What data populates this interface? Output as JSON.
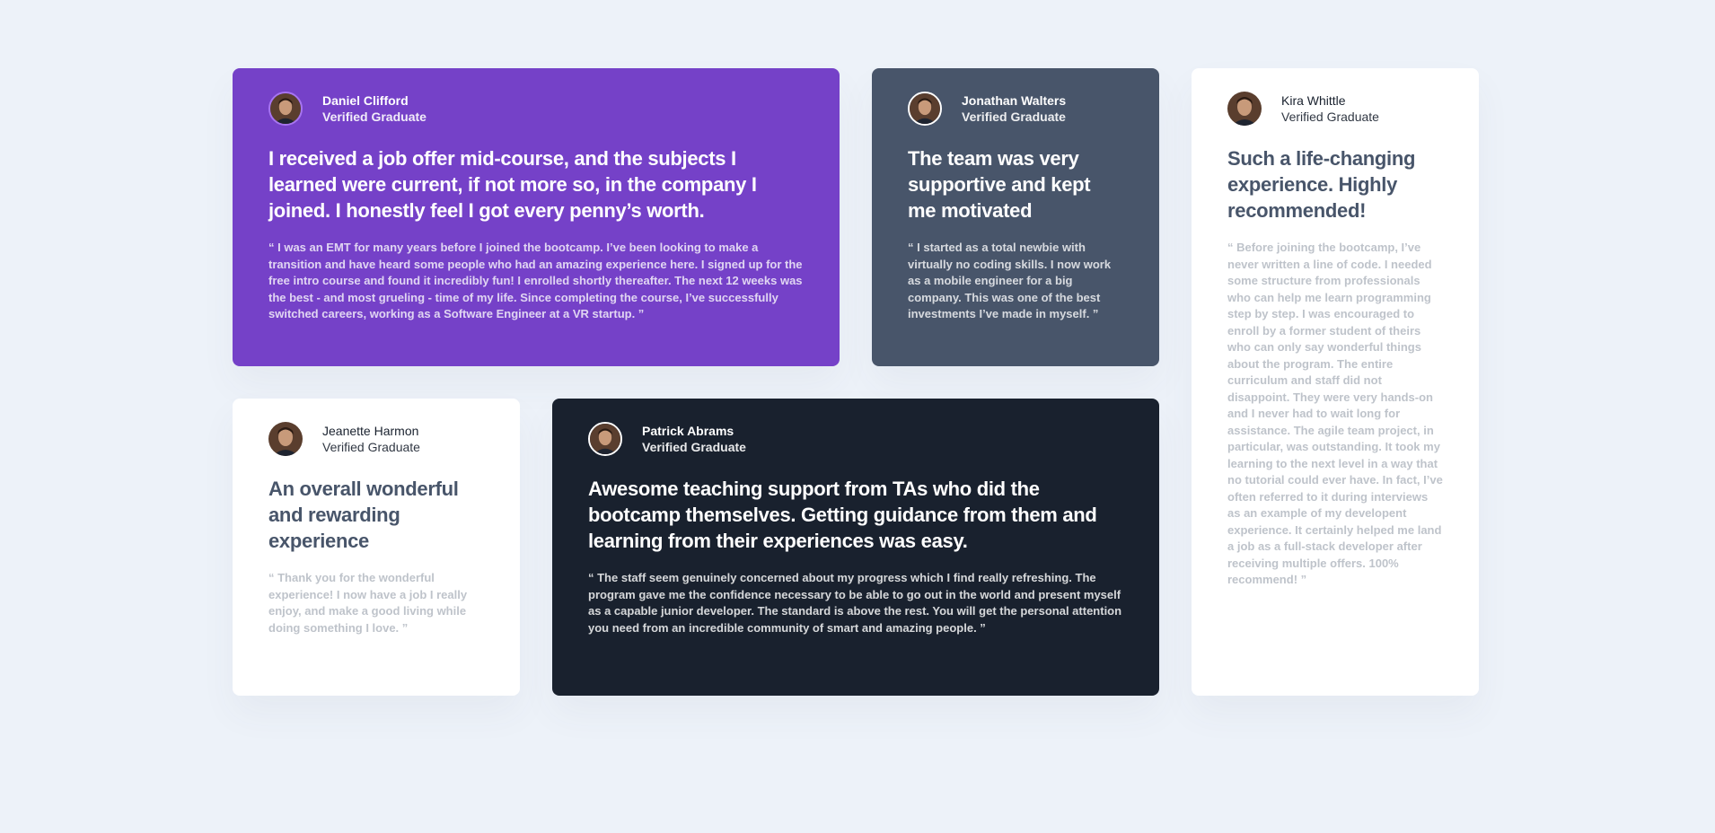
{
  "page": {
    "background": "#edf2f9"
  },
  "colors": {
    "purple_card": "#7541c8",
    "grey_card": "#48556a",
    "dark_card": "#19212e",
    "white_card": "#ffffff"
  },
  "testimonials": [
    {
      "name": "Daniel Clifford",
      "role": "Verified Graduate",
      "headline": "I received a job offer mid-course, and the subjects I learned were current, if not more so, in the company I joined. I honestly feel I got every penny’s worth.",
      "quote": "“ I was an EMT for many years before I joined the bootcamp. I’ve been looking to make a transition and have heard some people who had an amazing experience here. I signed up for the free intro course and found it incredibly fun! I enrolled shortly thereafter. The next 12 weeks was the best - and most grueling - time of my life. Since completing the course, I’ve successfully switched careers, working as a Software Engineer at a VR startup. ”",
      "avatar_icon": "avatar-photo-icon"
    },
    {
      "name": "Jonathan Walters",
      "role": "Verified Graduate",
      "headline": "The team was very supportive and kept me motivated",
      "quote": "“ I started as a total newbie with virtually no coding skills. I now work as a mobile engineer for a big company. This was one of the best investments I’ve made in myself. ”",
      "avatar_icon": "avatar-photo-icon"
    },
    {
      "name": "Kira Whittle",
      "role": "Verified Graduate",
      "headline": "Such a life-changing experience. Highly recommended!",
      "quote": "“ Before joining the bootcamp, I’ve never written a line of code. I needed some structure from professionals who can help me learn programming step by step. I was encouraged to enroll by a former student of theirs who can only say wonderful things about the program. The entire curriculum and staff did not disappoint. They were very hands-on and I never had to wait long for assistance. The agile team project, in particular, was outstanding. It took my learning to the next level in a way that no tutorial could ever have. In fact, I’ve often referred to it during interviews as an example of my developent experience. It certainly helped me land a job as a full-stack developer after receiving multiple offers. 100% recommend! ”",
      "avatar_icon": "avatar-photo-icon"
    },
    {
      "name": "Jeanette Harmon",
      "role": "Verified Graduate",
      "headline": "An overall wonderful and rewarding experience",
      "quote": "“ Thank you for the wonderful experience! I now have a job I really enjoy, and make a good living while doing something I love. ”",
      "avatar_icon": "avatar-photo-icon"
    },
    {
      "name": "Patrick Abrams",
      "role": "Verified Graduate",
      "headline": "Awesome teaching support from TAs who did the bootcamp themselves. Getting guidance from them and learning from their experiences was easy.",
      "quote": "“ The staff seem genuinely concerned about my progress which I find really refreshing. The program gave me the confidence necessary to be able to go out in the world and present myself as a capable junior developer. The standard is above the rest. You will get the personal attention you need from an incredible community of smart and amazing people. ”",
      "avatar_icon": "avatar-photo-icon"
    }
  ]
}
